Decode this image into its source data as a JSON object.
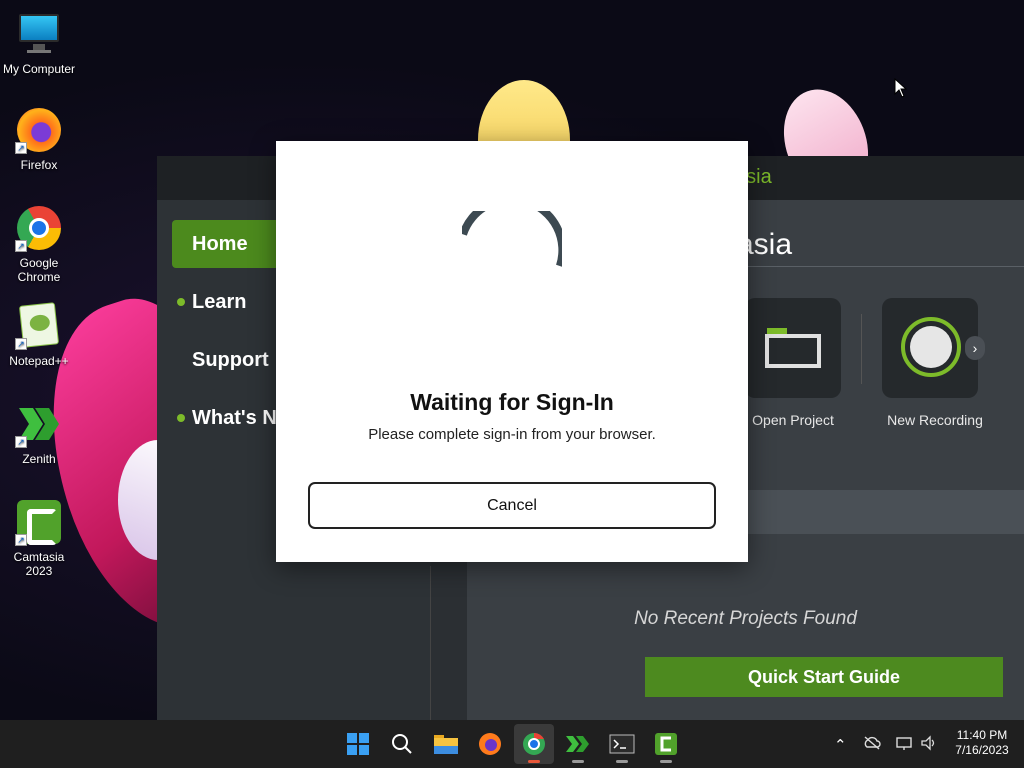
{
  "desktop": {
    "icons": [
      {
        "label": "My Computer",
        "icon": "computer-icon"
      },
      {
        "label": "Firefox",
        "icon": "firefox-icon"
      },
      {
        "label": "Google Chrome",
        "icon": "chrome-icon"
      },
      {
        "label": "Notepad++",
        "icon": "notepadpp-icon"
      },
      {
        "label": "Zenith",
        "icon": "zenith-icon"
      },
      {
        "label": "Camtasia 2023",
        "icon": "camtasia-icon"
      }
    ]
  },
  "camtasia": {
    "brand": "asia",
    "nav": [
      {
        "label": "Home",
        "active": true
      },
      {
        "label": "Learn",
        "active": false
      },
      {
        "label": "Support",
        "active": false
      },
      {
        "label": "What's N",
        "active": false
      }
    ],
    "title": "asia",
    "tiles": [
      {
        "label": "Open Project",
        "icon": "folder-icon"
      },
      {
        "label": "New Recording",
        "icon": "record-icon"
      }
    ],
    "no_recent": "No Recent Projects Found",
    "quick_start": "Quick Start Guide",
    "accent": "#4d8a1f"
  },
  "dialog": {
    "title": "Waiting for Sign-In",
    "message": "Please complete sign-in from your browser.",
    "cancel": "Cancel"
  },
  "taskbar": {
    "apps": [
      "start-icon",
      "search-icon",
      "file-explorer-icon",
      "firefox-icon",
      "chrome-icon",
      "zenith-icon",
      "terminal-icon",
      "camtasia-icon"
    ],
    "time": "11:40 PM",
    "date": "7/16/2023"
  }
}
